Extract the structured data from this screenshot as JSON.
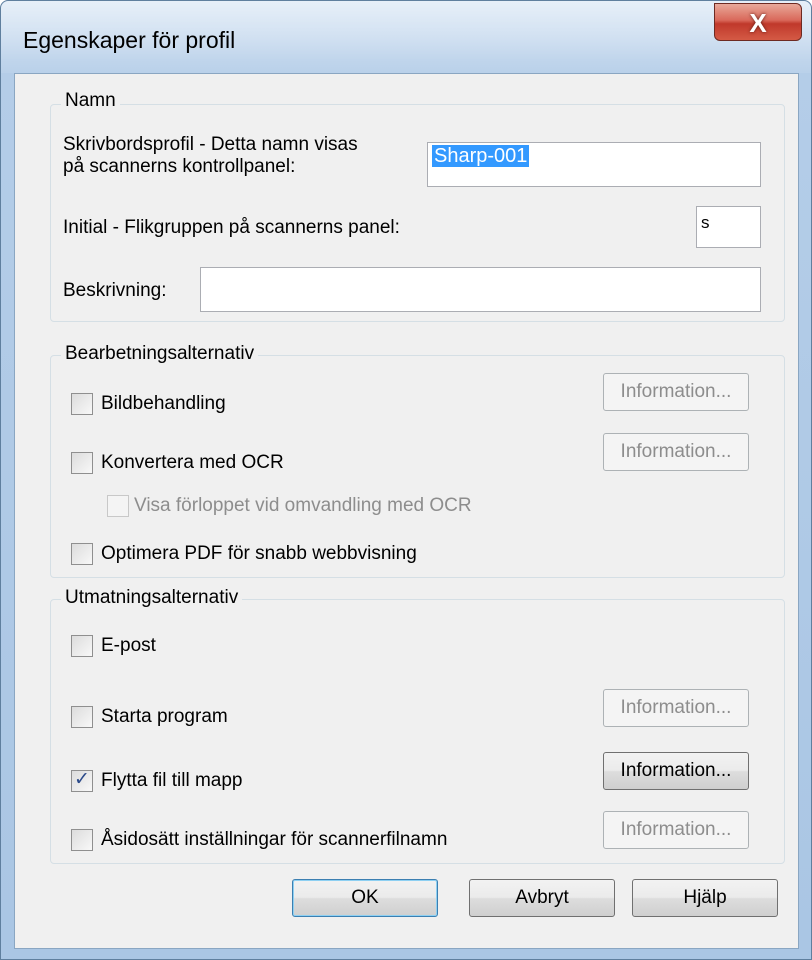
{
  "window": {
    "title": "Egenskaper för profil",
    "close_glyph": "X"
  },
  "namn": {
    "legend": "Namn",
    "profile_label_line1": "Skrivbordsprofil - Detta namn visas",
    "profile_label_line2": "på scannerns kontrollpanel:",
    "profile_value": "Sharp-001",
    "initial_label": "Initial - Flikgruppen på scannerns panel:",
    "initial_value": "s",
    "description_label": "Beskrivning:",
    "description_value": ""
  },
  "processing": {
    "legend": "Bearbetningsalternativ",
    "image_processing": {
      "label": "Bildbehandling",
      "checked": false,
      "info_label": "Information..."
    },
    "ocr": {
      "label": "Konvertera med OCR",
      "checked": false,
      "info_label": "Information..."
    },
    "ocr_progress": {
      "label": "Visa förloppet vid omvandling med OCR",
      "checked": false,
      "enabled": false
    },
    "optimize_pdf": {
      "label": "Optimera PDF för snabb webbvisning",
      "checked": false
    }
  },
  "output": {
    "legend": "Utmatningsalternativ",
    "email": {
      "label": "E-post",
      "checked": false
    },
    "start_program": {
      "label": "Starta program",
      "checked": false,
      "info_label": "Information..."
    },
    "move_file": {
      "label": "Flytta fil till mapp",
      "checked": true,
      "info_label": "Information..."
    },
    "override_filename": {
      "label": "Åsidosätt inställningar för scannerfilnamn",
      "checked": false,
      "info_label": "Information..."
    }
  },
  "buttons": {
    "ok": "OK",
    "cancel": "Avbryt",
    "help": "Hjälp"
  },
  "colors": {
    "selection": "#3399ff",
    "close_button": "#c0392b",
    "check_mark": "#2b4a8a"
  }
}
